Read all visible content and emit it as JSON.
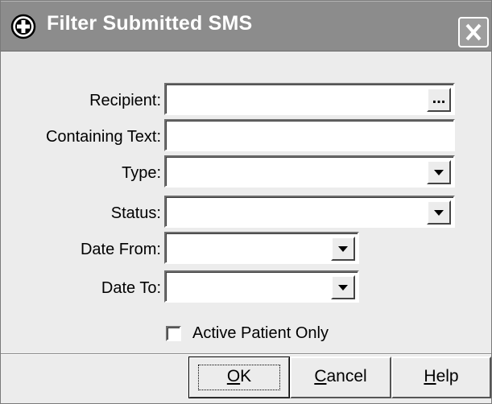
{
  "dialog": {
    "title": "Filter Submitted SMS",
    "title_icon": "plus-circle-icon",
    "close_icon": "close-icon"
  },
  "fields": {
    "recipient": {
      "label": "Recipient:",
      "value": "",
      "button_label": "..."
    },
    "containing_text": {
      "label": "Containing Text:",
      "value": ""
    },
    "type": {
      "label": "Type:",
      "value": ""
    },
    "status": {
      "label": "Status:",
      "value": ""
    },
    "date_from": {
      "label": "Date From:",
      "value": ""
    },
    "date_to": {
      "label": "Date To:",
      "value": ""
    }
  },
  "active_patient_only": {
    "label": "Active Patient Only",
    "checked": false
  },
  "buttons": {
    "ok": {
      "mnemonic": "O",
      "rest": "K"
    },
    "cancel": {
      "mnemonic": "C",
      "rest": "ancel"
    },
    "help": {
      "mnemonic": "H",
      "rest": "elp"
    }
  },
  "colors": {
    "titlebar": "#8c8c8c",
    "dialog_bg": "#ececec",
    "field_bg": "#ffffff"
  }
}
